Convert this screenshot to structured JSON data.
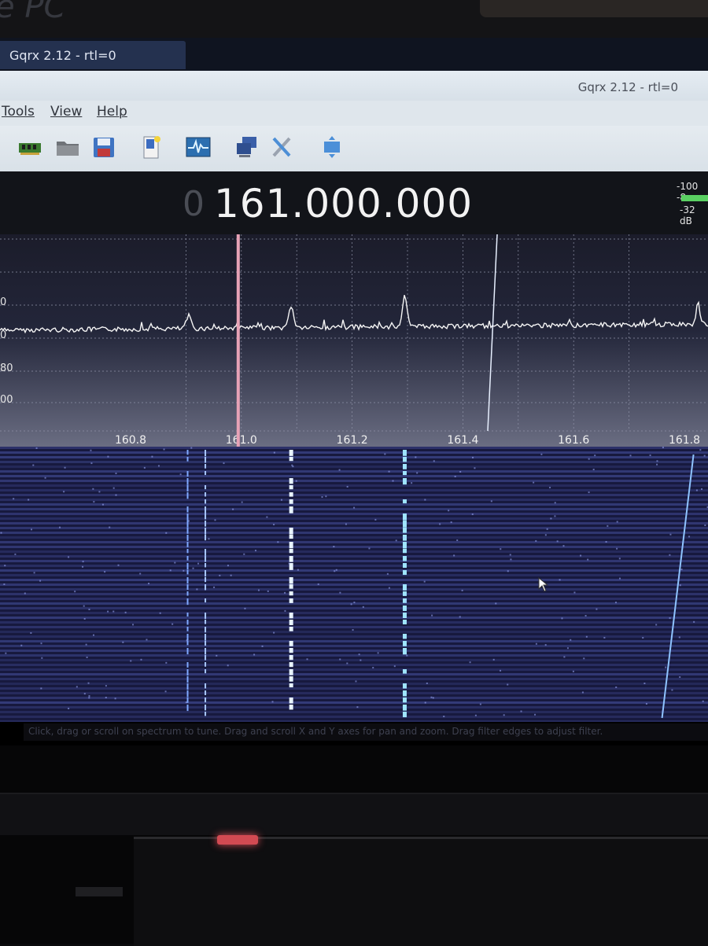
{
  "taskbar": {
    "window_label": "Gqrx 2.12 - rtl=0"
  },
  "window": {
    "title": "Gqrx 2.12 - rtl=0"
  },
  "menu": [
    "Tools",
    "View",
    "Help"
  ],
  "toolbar_icons": [
    "hardware-config-icon",
    "open-folder-icon",
    "save-icon",
    "bookmark-icon",
    "fft-settings-icon",
    "remote-control-icon",
    "tools-icon",
    "full-screen-icon"
  ],
  "frequency": {
    "prefix": "0",
    "value": "161.000.000"
  },
  "level_meter": {
    "scale_label": "-100 -8",
    "level_text": "-32 dB"
  },
  "spectrum": {
    "y_ticks": [
      "0",
      "0",
      "80",
      "00"
    ],
    "x_ticks": [
      "160.8",
      "161.0",
      "161.2",
      "161.4",
      "161.6",
      "161.8"
    ]
  },
  "chart_data": {
    "type": "line",
    "title": "",
    "xlabel": "",
    "ylabel": "",
    "x_ticks": [
      160.8,
      161.0,
      161.2,
      161.4,
      161.6,
      161.8
    ],
    "xlim": [
      160.6,
      161.85
    ],
    "peaks_mhz": [
      160.905,
      161.09,
      161.295,
      161.825
    ],
    "tuned_freq_mhz": 161.0,
    "grid": true
  },
  "status_text": "Click, drag or scroll on spectrum to tune. Drag and scroll X and Y axes for pan and zoom. Drag filter edges to adjust filter.",
  "colors": {
    "trace": "#f4f4f4",
    "tuning_marker": "#e7a2b6",
    "waterfall_bg": "#17193e",
    "accent_signal": "#9fe4ff"
  }
}
